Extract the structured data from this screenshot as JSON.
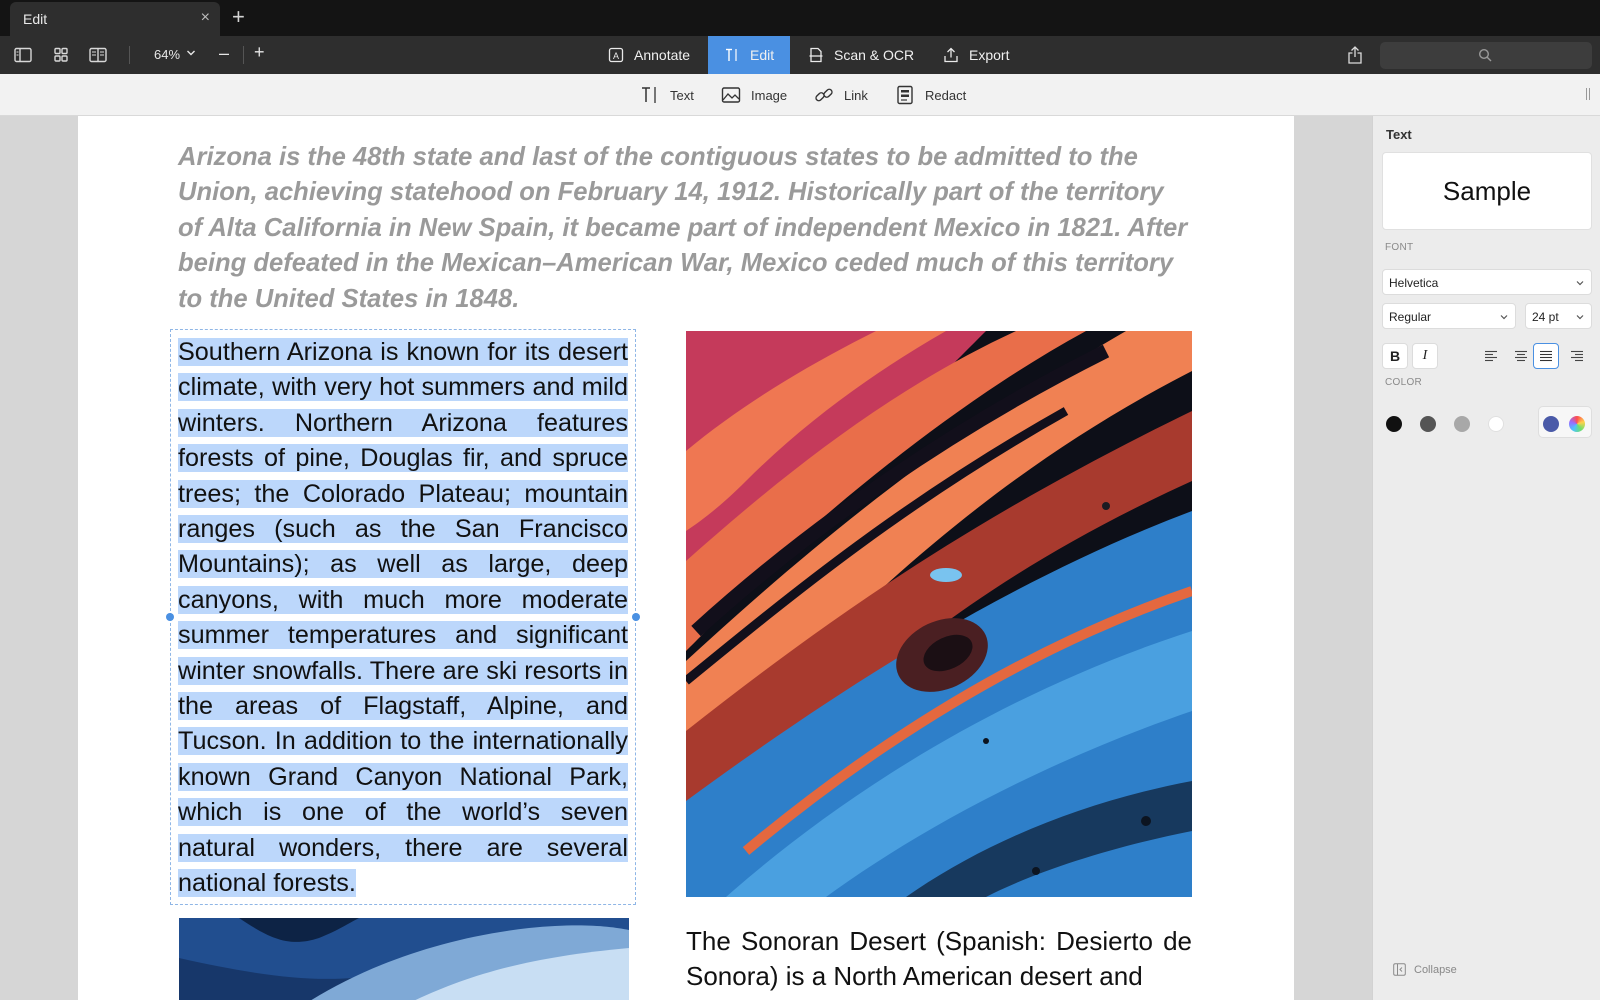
{
  "window": {
    "tab_label": "Edit",
    "tab_close": "×",
    "tab_add": "+"
  },
  "toolbar": {
    "zoom": "64%",
    "zoom_out": "–",
    "zoom_in": "+",
    "modes": [
      {
        "label": "Annotate",
        "icon": "annotate-icon",
        "active": false
      },
      {
        "label": "Edit",
        "icon": "text-cursor-icon",
        "active": true
      },
      {
        "label": "Scan & OCR",
        "icon": "scan-icon",
        "active": false
      },
      {
        "label": "Export",
        "icon": "export-icon",
        "active": false
      }
    ],
    "accent_color": "#4a90e2"
  },
  "edit_tools": [
    {
      "label": "Text",
      "icon": "text-cursor-icon"
    },
    {
      "label": "Image",
      "icon": "image-icon"
    },
    {
      "label": "Link",
      "icon": "link-icon"
    },
    {
      "label": "Redact",
      "icon": "redact-icon"
    }
  ],
  "document": {
    "heading": "Arizona is the 48th state and last of the contiguous states to be admitted to the Union, achieving statehood on February 14, 1912. Historically part of the territory of Alta California in New Spain, it became part of independent Mexico in 1821. After being defeated in the Mexican–American War, Mexico ceded much of this territory to the United States in 1848.",
    "selected_paragraph": "Southern Arizona is known for its desert climate, with very hot summers and mild winters. Northern Arizona features forests of pine, Douglas fir, and spruce trees; the Colorado Plateau; mountain ranges (such as the San Francisco Mountains); as well as large, deep canyons, with much more moderate summer temperatures and significant winter snowfalls. There are ski resorts in the areas of Flagstaff, Alpine, and Tucson. In addition to the internationally known Grand Canyon National Park, which is one of the world’s seven natural wonders, there are several national forests.",
    "second_paragraph": "The Sonoran Desert (Spanish: Desierto de Sonora) is a North American desert and",
    "selection_color": "#bcd7fb"
  },
  "text_panel": {
    "title": "Text",
    "sample": "Sample",
    "font_label": "FONT",
    "font_family": "Helvetica",
    "font_style": "Regular",
    "font_size": "24 pt",
    "bold": "B",
    "italic": "I",
    "alignments": [
      "align-left-icon",
      "align-center-icon",
      "align-justify-icon",
      "align-right-icon"
    ],
    "active_alignment": "justify",
    "color_label": "COLOR",
    "colors": [
      "#111111",
      "#555555",
      "#a8a8a8",
      "#ffffff",
      "#4a5aa8"
    ],
    "collapse": "Collapse"
  }
}
